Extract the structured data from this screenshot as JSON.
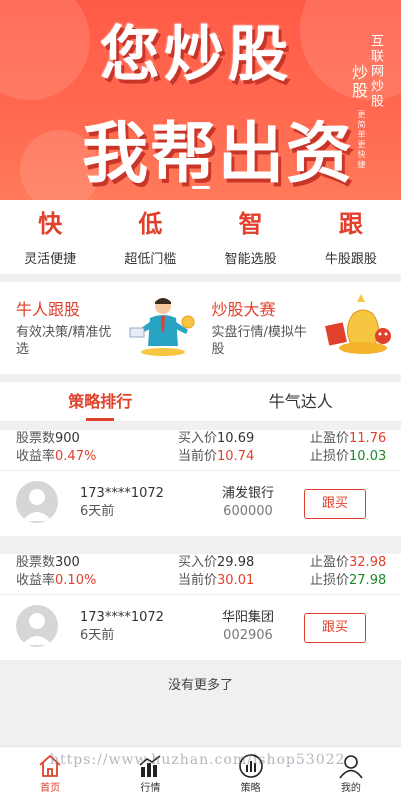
{
  "banner": {
    "line1": "您炒股",
    "line2": "我帮出资",
    "side_a": "互联网炒股",
    "side_b": "炒股",
    "side_c": "更简单更快捷"
  },
  "features": [
    {
      "big": "快",
      "small": "灵活便捷"
    },
    {
      "big": "低",
      "small": "超低门槛"
    },
    {
      "big": "智",
      "small": "智能选股"
    },
    {
      "big": "跟",
      "small": "牛股跟股"
    }
  ],
  "promo": [
    {
      "title": "牛人跟股",
      "desc": "有效决策/精准优选"
    },
    {
      "title": "炒股大赛",
      "desc": "实盘行情/模拟牛股"
    }
  ],
  "tabs": [
    {
      "label": "策略排行"
    },
    {
      "label": "牛气达人"
    }
  ],
  "records": [
    {
      "shares_label": "股票数",
      "shares": "900",
      "yield_label": "收益率",
      "yield": "0.47%",
      "buy_label": "买入价",
      "buy": "10.69",
      "cur_label": "当前价",
      "cur": "10.74",
      "tp_label": "止盈价",
      "tp": "11.76",
      "sl_label": "止损价",
      "sl": "10.03",
      "user": "173****1072",
      "ago": "6天前",
      "stock_name": "浦发银行",
      "stock_code": "600000",
      "follow": "跟买"
    },
    {
      "shares_label": "股票数",
      "shares": "300",
      "yield_label": "收益率",
      "yield": "0.10%",
      "buy_label": "买入价",
      "buy": "29.98",
      "cur_label": "当前价",
      "cur": "30.01",
      "tp_label": "止盈价",
      "tp": "32.98",
      "sl_label": "止损价",
      "sl": "27.98",
      "user": "173****1072",
      "ago": "6天前",
      "stock_name": "华阳集团",
      "stock_code": "002906",
      "follow": "跟买"
    }
  ],
  "nomore": "没有更多了",
  "watermark": "https://www.huzhan.com/ishop53022",
  "nav": [
    {
      "label": "首页",
      "icon": "home-icon"
    },
    {
      "label": "行情",
      "icon": "bar-chart-icon"
    },
    {
      "label": "策略",
      "icon": "strategy-icon"
    },
    {
      "label": "我的",
      "icon": "user-icon"
    }
  ],
  "colors": {
    "accent": "#e0402c",
    "green": "#1a8a2a",
    "banner": "#ff5a46"
  }
}
